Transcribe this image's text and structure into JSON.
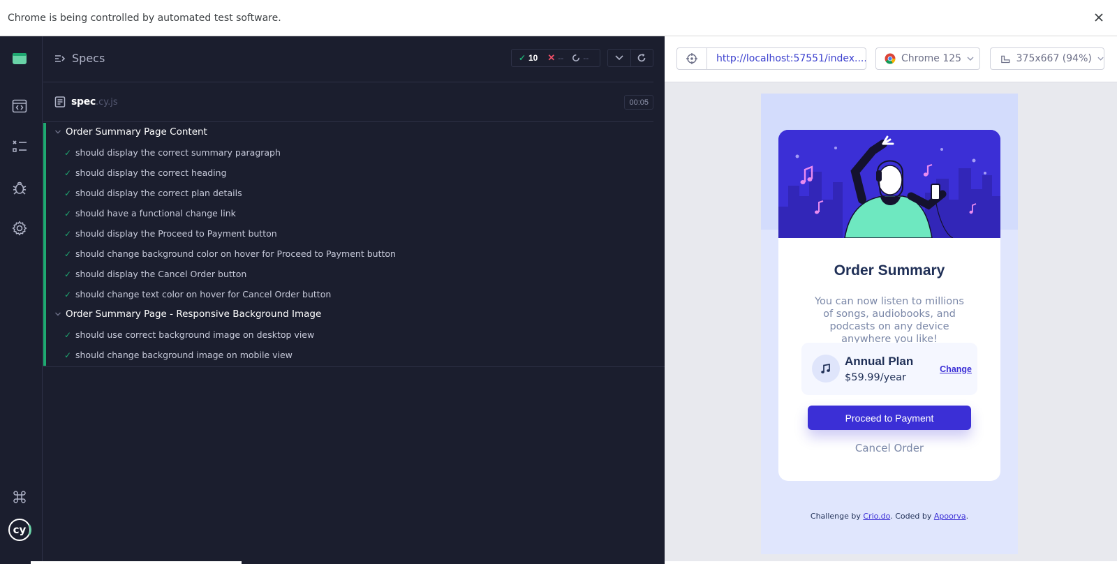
{
  "infobar": {
    "text": "Chrome is being controlled by automated test software."
  },
  "reporter": {
    "specs_label": "Specs",
    "stats": {
      "passed": "10",
      "failed": "--",
      "pending": "--"
    },
    "spec": {
      "file": "spec",
      "ext": ".cy.js",
      "time": "00:05"
    },
    "suites": [
      {
        "title": "Order Summary Page Content",
        "tests": [
          "should display the correct summary paragraph",
          "should display the correct heading",
          "should display the correct plan details",
          "should have a functional change link",
          "should display the Proceed to Payment button",
          "should change background color on hover for Proceed to Payment button",
          "should display the Cancel Order button",
          "should change text color on hover for Cancel Order button"
        ]
      },
      {
        "title": "Order Summary Page - Responsive Background Image",
        "tests": [
          "should use correct background image on desktop view",
          "should change background image on mobile view"
        ]
      }
    ]
  },
  "aut": {
    "url": "http://localhost:57551/index....",
    "browser": "Chrome 125",
    "viewport": "375x667 (94%)"
  },
  "app": {
    "title": "Order Summary",
    "description": "You can now listen to millions of songs, audiobooks, and podcasts on any device anywhere you like!",
    "plan_name": "Annual Plan",
    "plan_price": "$59.99/year",
    "change_label": "Change",
    "pay_label": "Proceed to Payment",
    "cancel_label": "Cancel Order",
    "attribution": {
      "prefix": "Challenge by ",
      "link1": "Crio.do",
      "middle": ". Coded by ",
      "link2": "Apoorva",
      "suffix": "."
    }
  },
  "colors": {
    "pass": "#1fa971",
    "fail": "#f04f68",
    "brand": "#3b2fd6",
    "nav_bg": "#1b1e2e"
  }
}
